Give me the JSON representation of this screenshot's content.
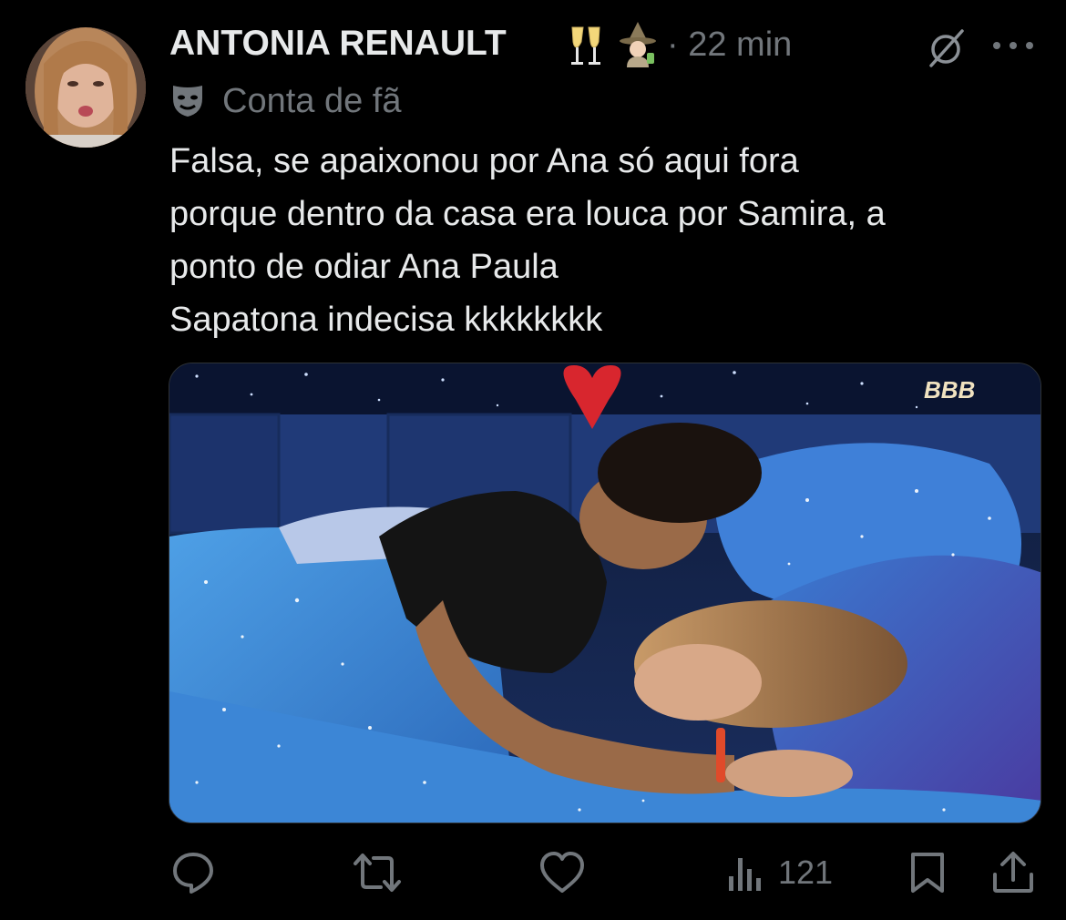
{
  "tweet": {
    "author_name": "ANTONIA RENAULT",
    "time": "· 22 min",
    "community_label": "Conta de fã",
    "text_lines": [
      "Falsa, se apaixonou por Ana só aqui fora",
      "porque dentro da casa era louca por Samira, a",
      "ponto de odiar Ana Paula",
      "Sapatona indecisa kkkkkkkk"
    ],
    "media": {
      "watermark": "BBB"
    }
  },
  "actions": {
    "views": "121"
  },
  "icons": {
    "name_emojis": [
      "clinking-glasses-emoji",
      "witch-emoji"
    ],
    "subline": "performing-arts-mask-icon",
    "header_right": [
      "grok-icon",
      "more-icon"
    ],
    "action_bar": [
      "reply-icon",
      "retweet-icon",
      "like-icon",
      "views-icon",
      "bookmark-icon",
      "share-icon"
    ]
  },
  "colors": {
    "background": "#000000",
    "primary_text": "#e7e9ea",
    "secondary_text": "#71767b"
  }
}
